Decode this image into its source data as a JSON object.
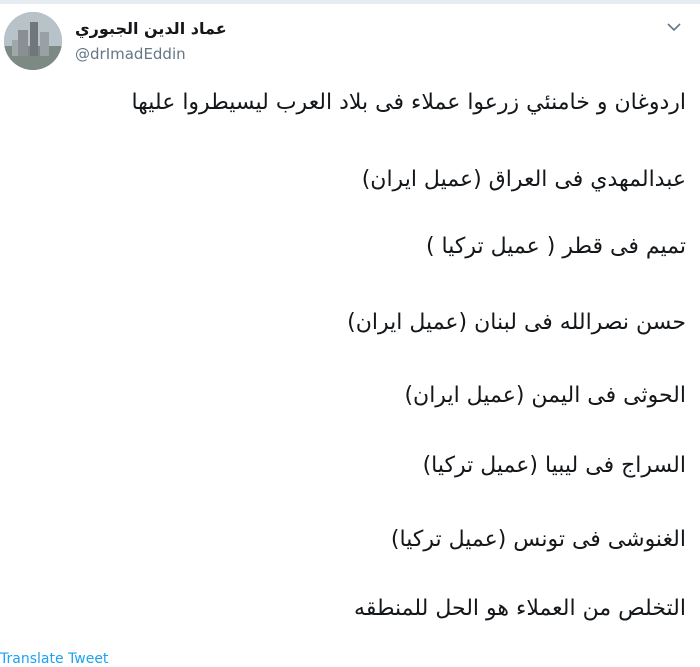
{
  "author": {
    "display_name": "عماد الدين الجبوري",
    "handle": "@drImadEddin"
  },
  "menu": {
    "icon": "chevron-down-icon"
  },
  "tweet": {
    "lines": [
      "اردوغان و خامنئي زرعوا عملاء فى بلاد العرب ليسيطروا عليها",
      "عبدالمهدي فى العراق (عميل ايران)",
      "تميم فى قطر ( عميل تركيا )",
      "حسن نصرالله فى لبنان (عميل ايران)",
      "الحوثى فى اليمن (عميل ايران)",
      "السراج فى ليبيا (عميل تركيا)",
      "الغنوشى فى تونس (عميل تركيا)",
      "التخلص من العملاء هو الحل للمنطقه"
    ]
  },
  "actions": {
    "translate_label": "Translate Tweet"
  },
  "colors": {
    "link": "#1da1f2",
    "muted": "#657786",
    "text": "#14171a"
  }
}
